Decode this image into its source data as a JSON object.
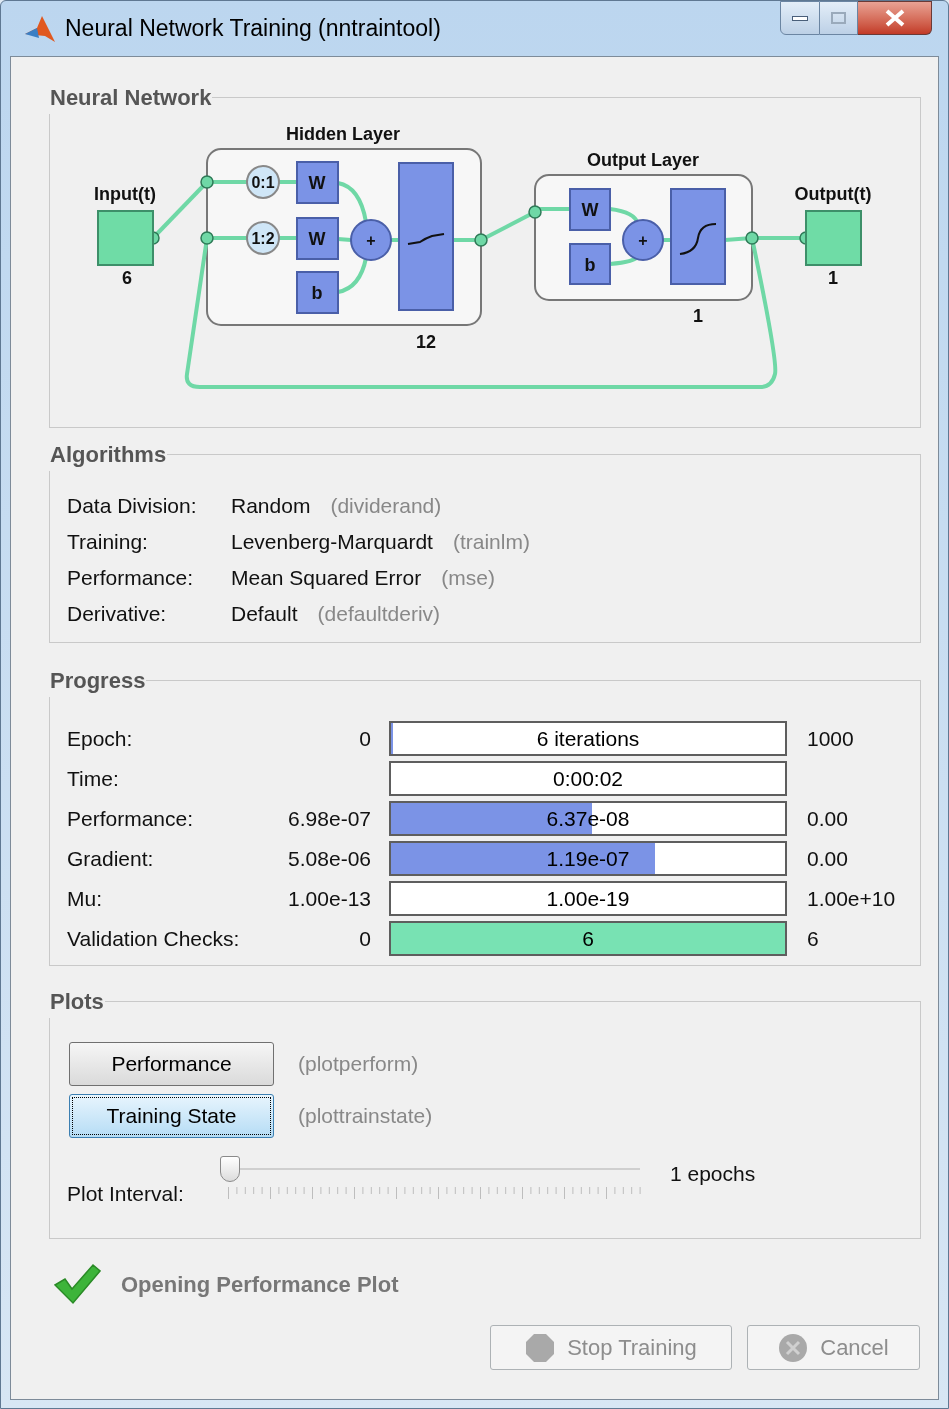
{
  "window": {
    "title": "Neural Network Training (nntraintool)"
  },
  "network": {
    "title": "Neural Network",
    "input": {
      "label": "Input(t)",
      "size": "6"
    },
    "hidden_layer": {
      "title": "Hidden Layer",
      "size": "12",
      "delays": [
        {
          "label": "0:1",
          "weight": "W"
        },
        {
          "label": "1:2",
          "weight": "W"
        }
      ],
      "bias": "b",
      "sum": "+"
    },
    "output_layer": {
      "title": "Output Layer",
      "size": "1",
      "weight": "W",
      "bias": "b",
      "sum": "+"
    },
    "output": {
      "label": "Output(t)",
      "size": "1"
    }
  },
  "algorithms": {
    "title": "Algorithms",
    "rows": [
      {
        "label": "Data Division:",
        "value": "Random",
        "function": "(dividerand)"
      },
      {
        "label": "Training:",
        "value": "Levenberg-Marquardt",
        "function": "(trainlm)"
      },
      {
        "label": "Performance:",
        "value": "Mean Squared Error",
        "function": "(mse)"
      },
      {
        "label": "Derivative:",
        "value": "Default",
        "function": "(defaultderiv)"
      }
    ]
  },
  "progress": {
    "title": "Progress",
    "rows": [
      {
        "label": "Epoch:",
        "start": "0",
        "reading": "6 iterations",
        "end": "1000",
        "level": 0.006,
        "color": "#7b93e6"
      },
      {
        "label": "Time:",
        "reading": "0:00:02",
        "level": 0
      },
      {
        "label": "Performance:",
        "start": "6.98e-07",
        "reading": "6.37e-08",
        "end": "0.00",
        "level": 0.51,
        "color": "#7b93e6"
      },
      {
        "label": "Gradient:",
        "start": "5.08e-06",
        "reading": "1.19e-07",
        "end": "0.00",
        "level": 0.67,
        "color": "#7b93e6"
      },
      {
        "label": "Mu:",
        "start": "1.00e-13",
        "reading": "1.00e-19",
        "end": "1.00e+10",
        "level": 0
      },
      {
        "label": "Validation Checks:",
        "start": "0",
        "reading": "6",
        "end": "6",
        "level": 1,
        "color": "#78e2b3"
      }
    ]
  },
  "plots": {
    "title": "Plots",
    "buttons": [
      {
        "label": "Performance",
        "function": "(plotperform)",
        "selected": false
      },
      {
        "label": "Training State",
        "function": "(plottrainstate)",
        "selected": true
      }
    ],
    "interval": {
      "label": "Plot Interval:",
      "level": 0,
      "reading": "1 epochs"
    }
  },
  "status": {
    "text": "Opening Performance Plot"
  },
  "buttons": [
    {
      "label": "Stop Training",
      "kind": "stop",
      "disabled": true
    },
    {
      "label": "Cancel",
      "kind": "cancel",
      "disabled": true
    }
  ]
}
